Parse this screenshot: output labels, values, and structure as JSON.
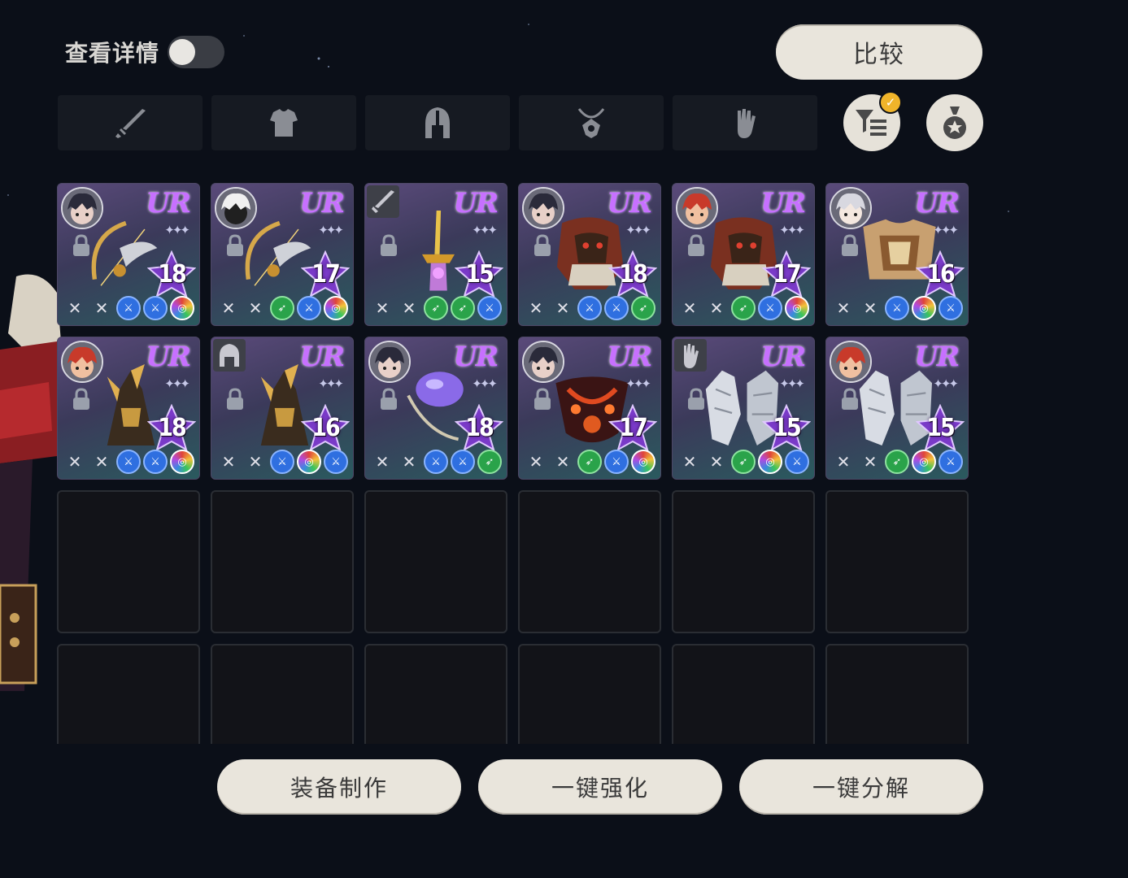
{
  "header": {
    "detail_label": "查看详情",
    "toggle_on": false,
    "compare_label": "比较"
  },
  "tabs": [
    {
      "name": "weapon",
      "icon": "sword-icon"
    },
    {
      "name": "armor",
      "icon": "armor-icon"
    },
    {
      "name": "helmet",
      "icon": "helmet-icon"
    },
    {
      "name": "necklace",
      "icon": "necklace-icon"
    },
    {
      "name": "gloves",
      "icon": "glove-icon"
    }
  ],
  "tools": [
    {
      "icon": "filter-icon",
      "checked": true
    },
    {
      "icon": "medal-icon"
    }
  ],
  "items": [
    {
      "rarity": "UR",
      "level": "18",
      "owner": "avatar-dark-hair",
      "art": "golden-bow",
      "subs": [
        "g",
        "g",
        "b",
        "b",
        "rb"
      ]
    },
    {
      "rarity": "UR",
      "level": "17",
      "owner": "avatar-white-dark",
      "art": "golden-bow",
      "subs": [
        "g",
        "g",
        "gr",
        "b",
        "rb"
      ]
    },
    {
      "rarity": "UR",
      "level": "15",
      "owner": "type-sword",
      "art": "golden-sword",
      "subs": [
        "g",
        "g",
        "gr",
        "gr",
        "b"
      ]
    },
    {
      "rarity": "UR",
      "level": "18",
      "owner": "avatar-dark-hair",
      "art": "lion-armor",
      "subs": [
        "g",
        "g",
        "b",
        "b",
        "gr"
      ]
    },
    {
      "rarity": "UR",
      "level": "17",
      "owner": "avatar-red-hat",
      "art": "lion-armor",
      "subs": [
        "g",
        "g",
        "gr",
        "b",
        "rb"
      ]
    },
    {
      "rarity": "UR",
      "level": "16",
      "owner": "avatar-silver-hair",
      "art": "gold-chest",
      "subs": [
        "g",
        "g",
        "b",
        "rb",
        "b"
      ]
    },
    {
      "rarity": "UR",
      "level": "18",
      "owner": "avatar-red-hat",
      "art": "horned-helm",
      "subs": [
        "g",
        "g",
        "b",
        "b",
        "rb"
      ]
    },
    {
      "rarity": "UR",
      "level": "16",
      "owner": "type-helmet",
      "art": "horned-helm",
      "subs": [
        "g",
        "g",
        "b",
        "rb",
        "b"
      ]
    },
    {
      "rarity": "UR",
      "level": "18",
      "owner": "avatar-dark-hair",
      "art": "purple-orb",
      "subs": [
        "g",
        "g",
        "b",
        "b",
        "gr"
      ]
    },
    {
      "rarity": "UR",
      "level": "17",
      "owner": "avatar-dark-hair",
      "art": "fire-necklace",
      "subs": [
        "g",
        "g",
        "gr",
        "b",
        "rb"
      ]
    },
    {
      "rarity": "UR",
      "level": "15",
      "owner": "type-glove",
      "art": "silver-gauntlet",
      "subs": [
        "g",
        "g",
        "gr",
        "rb",
        "b"
      ]
    },
    {
      "rarity": "UR",
      "level": "15",
      "owner": "avatar-red-hat",
      "art": "silver-gauntlet",
      "subs": [
        "g",
        "g",
        "gr",
        "rb",
        "b"
      ]
    }
  ],
  "empty_slots": 12,
  "bottom": {
    "craft_label": "装备制作",
    "enhance_label": "一键强化",
    "dismantle_label": "一键分解"
  }
}
